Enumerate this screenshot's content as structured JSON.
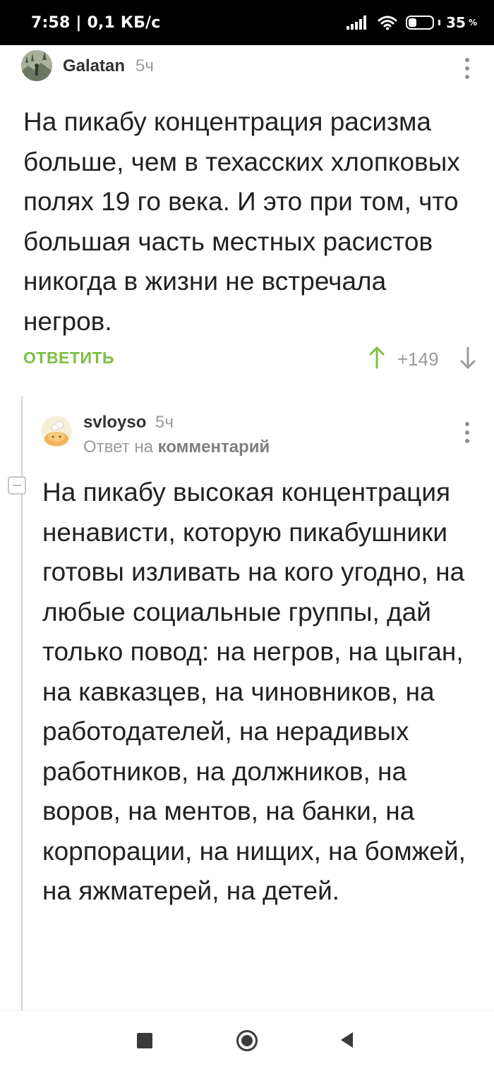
{
  "status_bar": {
    "time": "7:58 | 0,1 КБ/с",
    "battery": "35",
    "battery_level": 0.35,
    "battery_unit": "%"
  },
  "comments": [
    {
      "username": "Galatan",
      "time_ago": "5ч",
      "text": "На пикабу концентрация расизма больше, чем в техасских хлопковых полях 19 го века. И это при том, что большая часть местных расистов никогда в жизни не встречала негров.",
      "reply_label": "ОТВЕТИТЬ",
      "rating": "+149"
    },
    {
      "username": "svloyso",
      "time_ago": "5ч",
      "reply_prefix": "Ответ на",
      "reply_target": "комментарий",
      "text": "На пикабу высокая концентрация ненависти, которую пикабушники готовы изливать на кого угодно, на любые социальные группы, дай только повод: на негров, на цыган, на кавказцев, на чиновников, на работодателей, на нерадивых работников, на должников, на воров, на ментов, на банки, на корпорации, на нищих, на бомжей, на яжматерей, на детей."
    }
  ],
  "icons": {
    "comment_menu": "kebab-menu-icon",
    "upvote": "arrow-up-icon",
    "downvote": "arrow-down-icon",
    "collapse": "minus-box-icon",
    "nav_recent": "square-icon",
    "nav_home": "circle-icon",
    "nav_back": "triangle-back-icon"
  },
  "colors": {
    "accent_green": "#7cbf44",
    "muted_text": "#9a9a9a",
    "body_text": "#222222",
    "thread_line": "#cfcfcf"
  }
}
